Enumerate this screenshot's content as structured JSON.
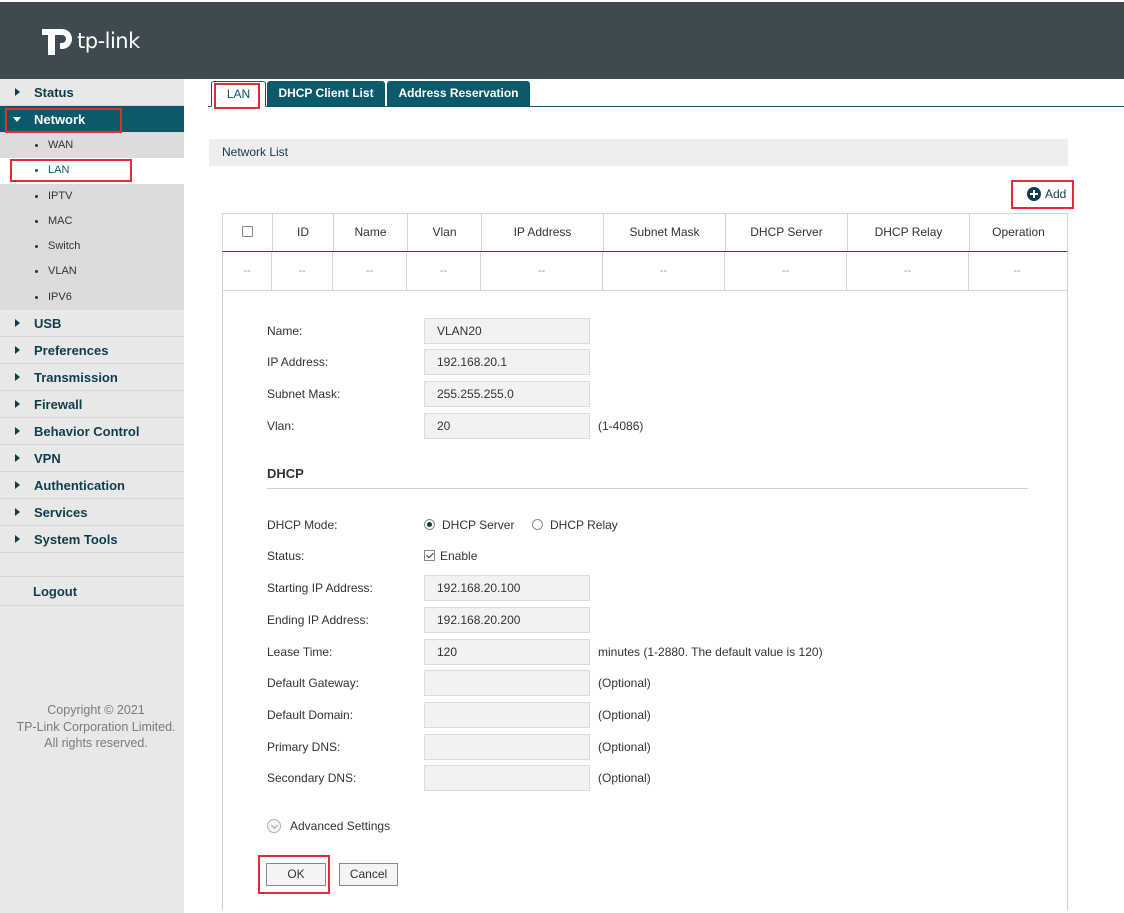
{
  "brand": {
    "logo_text": "tp-link"
  },
  "sidebar": {
    "items": [
      {
        "label": "Status"
      },
      {
        "label": "Network"
      },
      {
        "label": "USB"
      },
      {
        "label": "Preferences"
      },
      {
        "label": "Transmission"
      },
      {
        "label": "Firewall"
      },
      {
        "label": "Behavior Control"
      },
      {
        "label": "VPN"
      },
      {
        "label": "Authentication"
      },
      {
        "label": "Services"
      },
      {
        "label": "System Tools"
      }
    ],
    "network_sub": [
      "WAN",
      "LAN",
      "IPTV",
      "MAC",
      "Switch",
      "VLAN",
      "IPV6"
    ],
    "logout": "Logout",
    "copyright": [
      "Copyright © 2021",
      "TP-Link Corporation Limited.",
      "All rights reserved."
    ]
  },
  "tabs": [
    {
      "label": "LAN"
    },
    {
      "label": "DHCP Client List"
    },
    {
      "label": "Address Reservation"
    }
  ],
  "panel": {
    "title": "Network List",
    "add_label": "Add"
  },
  "table": {
    "headers": [
      "ID",
      "Name",
      "Vlan",
      "IP Address",
      "Subnet Mask",
      "DHCP Server",
      "DHCP Relay",
      "Operation"
    ],
    "empty_row": [
      "--",
      "--",
      "--",
      "--",
      "--",
      "--",
      "--",
      "--",
      "--"
    ]
  },
  "form": {
    "name": {
      "label": "Name:",
      "value": "VLAN20"
    },
    "ip": {
      "label": "IP Address:",
      "value": "192.168.20.1"
    },
    "mask": {
      "label": "Subnet Mask:",
      "value": "255.255.255.0"
    },
    "vlan": {
      "label": "Vlan:",
      "value": "20",
      "note": "(1-4086)"
    },
    "dhcp_title": "DHCP",
    "dhcp_mode": {
      "label": "DHCP Mode:",
      "option_server": "DHCP Server",
      "option_relay": "DHCP Relay",
      "selected": "DHCP Server"
    },
    "status": {
      "label": "Status:",
      "checkbox_label": "Enable",
      "checked": true
    },
    "start_ip": {
      "label": "Starting IP Address:",
      "value": "192.168.20.100"
    },
    "end_ip": {
      "label": "Ending IP Address:",
      "value": "192.168.20.200"
    },
    "lease": {
      "label": "Lease Time:",
      "value": "120",
      "note": "minutes (1-2880. The default value is 120)"
    },
    "gateway": {
      "label": "Default Gateway:",
      "value": "",
      "note": "(Optional)"
    },
    "domain": {
      "label": "Default Domain:",
      "value": "",
      "note": "(Optional)"
    },
    "dns1": {
      "label": "Primary DNS:",
      "value": "",
      "note": "(Optional)"
    },
    "dns2": {
      "label": "Secondary DNS:",
      "value": "",
      "note": "(Optional)"
    },
    "advanced": "Advanced Settings",
    "ok": "OK",
    "cancel": "Cancel"
  },
  "colors": {
    "header": "#3d4a50",
    "accent": "#0a5a6b",
    "highlight": "#e32b39"
  }
}
